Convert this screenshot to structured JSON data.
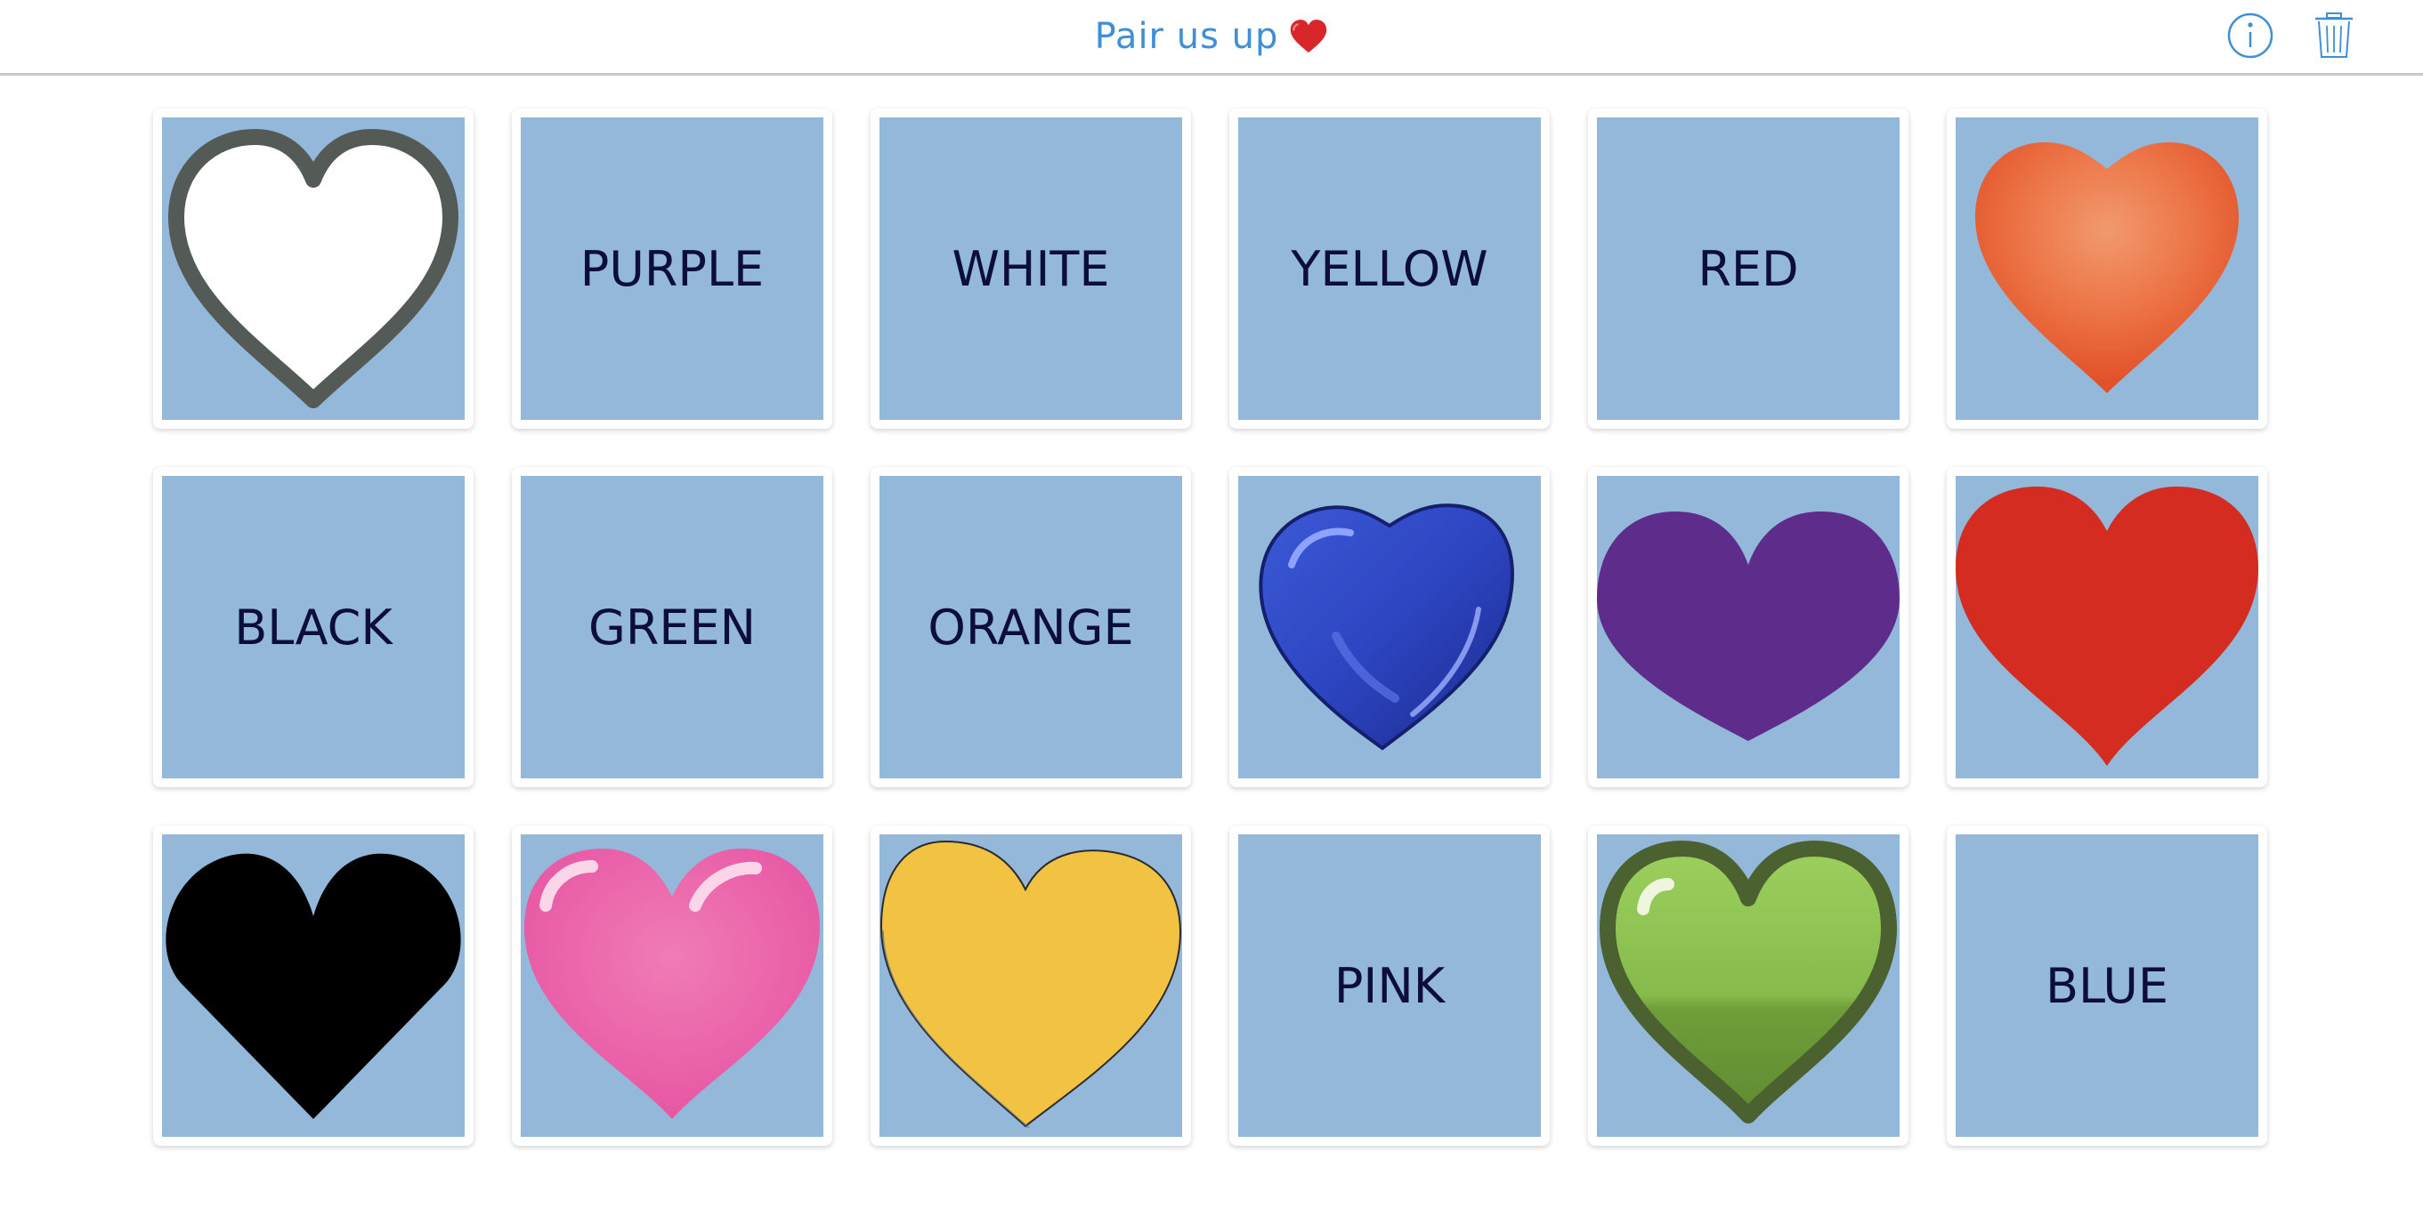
{
  "header": {
    "title": "Pair us up",
    "title_icon": "red-heart-icon",
    "info_icon": "info-icon",
    "trash_icon": "trash-icon",
    "accent_color": "#3f8fd6"
  },
  "board": {
    "card_face_color": "#93b8d9",
    "word_color": "#0c0d3a",
    "rows": [
      [
        {
          "kind": "heart",
          "heart": "white-heart-icon"
        },
        {
          "kind": "word",
          "text": "PURPLE"
        },
        {
          "kind": "word",
          "text": "WHITE"
        },
        {
          "kind": "word",
          "text": "YELLOW"
        },
        {
          "kind": "word",
          "text": "RED"
        },
        {
          "kind": "heart",
          "heart": "orange-heart-icon"
        }
      ],
      [
        {
          "kind": "word",
          "text": "BLACK"
        },
        {
          "kind": "word",
          "text": "GREEN"
        },
        {
          "kind": "word",
          "text": "ORANGE"
        },
        {
          "kind": "heart",
          "heart": "blue-heart-icon"
        },
        {
          "kind": "heart",
          "heart": "purple-heart-icon"
        },
        {
          "kind": "heart",
          "heart": "red-heart-icon"
        }
      ],
      [
        {
          "kind": "heart",
          "heart": "black-heart-icon"
        },
        {
          "kind": "heart",
          "heart": "pink-heart-icon"
        },
        {
          "kind": "heart",
          "heart": "yellow-heart-icon"
        },
        {
          "kind": "word",
          "text": "PINK"
        },
        {
          "kind": "heart",
          "heart": "green-heart-icon"
        },
        {
          "kind": "word",
          "text": "BLUE"
        }
      ]
    ]
  }
}
